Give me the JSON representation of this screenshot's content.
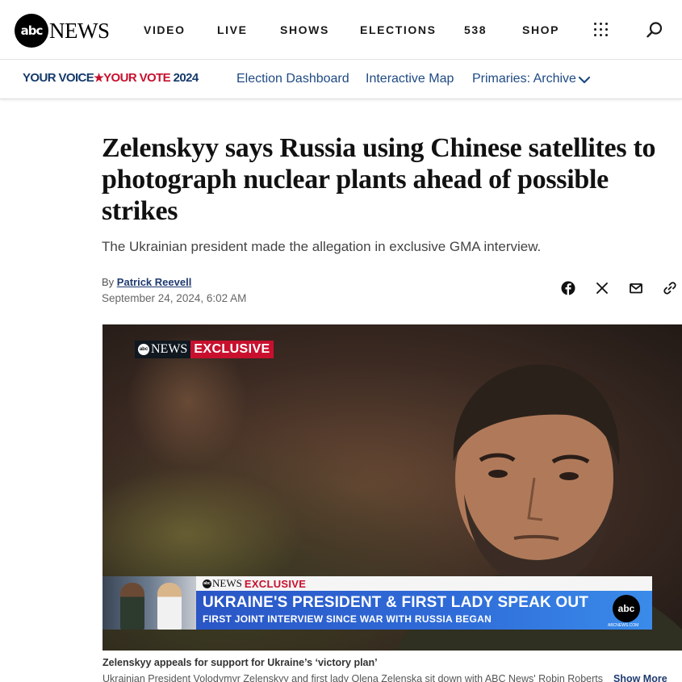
{
  "header": {
    "logo_circle": "abc",
    "logo_text": "NEWS",
    "nav": [
      "VIDEO",
      "LIVE",
      "SHOWS",
      "ELECTIONS",
      "538",
      "SHOP"
    ],
    "menu_icon": "grid-dots-icon",
    "search_icon": "search-icon"
  },
  "subnav": {
    "brand_part1": "YOUR VOICE",
    "brand_star": "★",
    "brand_part2": "YOUR VOTE",
    "brand_year": "2024",
    "links": [
      "Election Dashboard",
      "Interactive Map",
      "Primaries: Archive"
    ]
  },
  "article": {
    "headline": "Zelenskyy says Russia using Chinese satellites to photograph nuclear plants ahead of possible strikes",
    "subhead": "The Ukrainian president made the allegation in exclusive GMA interview.",
    "by_prefix": "By",
    "author": "Patrick Reevell",
    "date": "September 24, 2024, 6:02 AM",
    "share_icons": [
      "facebook-icon",
      "x-icon",
      "email-icon",
      "link-icon"
    ]
  },
  "video": {
    "bug_logo": "abc",
    "bug_news": "NEWS",
    "bug_exclusive": "EXCLUSIVE",
    "lower_third": {
      "tag_news": "NEWS",
      "tag_exclusive": "EXCLUSIVE",
      "title": "UKRAINE'S PRESIDENT & FIRST LADY SPEAK OUT",
      "subtitle": "FIRST JOINT INTERVIEW SINCE WAR WITH RUSSIA BEGAN",
      "logo": "abc",
      "url": "ABCNEWS.COM"
    },
    "caption_title": "Zelenskyy appeals for support for Ukraine’s ‘victory plan’",
    "caption_text": "Ukrainian President Volodymyr Zelenskyy and first lady Olena Zelenska sit down with ABC News' Robin Roberts",
    "show_more": "Show More"
  }
}
